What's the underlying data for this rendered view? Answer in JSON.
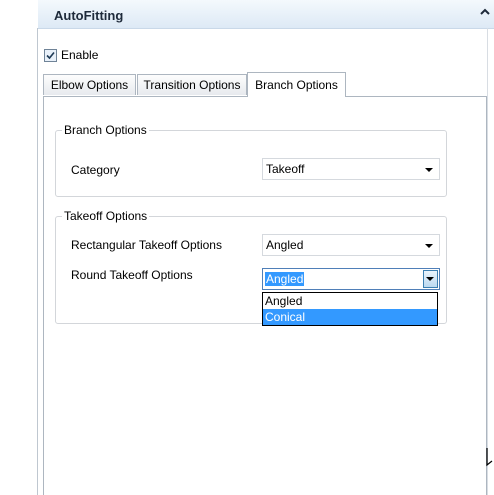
{
  "header": {
    "title": "AutoFitting",
    "collapse_icon": "chevron-up-icon"
  },
  "enable": {
    "label": "Enable",
    "checked": true
  },
  "tabs": [
    {
      "label": "Elbow Options",
      "active": false
    },
    {
      "label": "Transition Options",
      "active": false
    },
    {
      "label": "Branch Options",
      "active": true
    }
  ],
  "branch_options": {
    "group_title": "Branch Options",
    "category_label": "Category",
    "category_value": "Takeoff"
  },
  "takeoff_options": {
    "group_title": "Takeoff Options",
    "rect_label": "Rectangular Takeoff Options",
    "rect_value": "Angled",
    "round_label": "Round Takeoff Options",
    "round_value": "Angled",
    "dropdown_options": [
      "Angled",
      "Conical"
    ],
    "highlighted_option": "Conical"
  },
  "colors": {
    "selection": "#3399ff",
    "header_bg": "#dde9f5"
  }
}
